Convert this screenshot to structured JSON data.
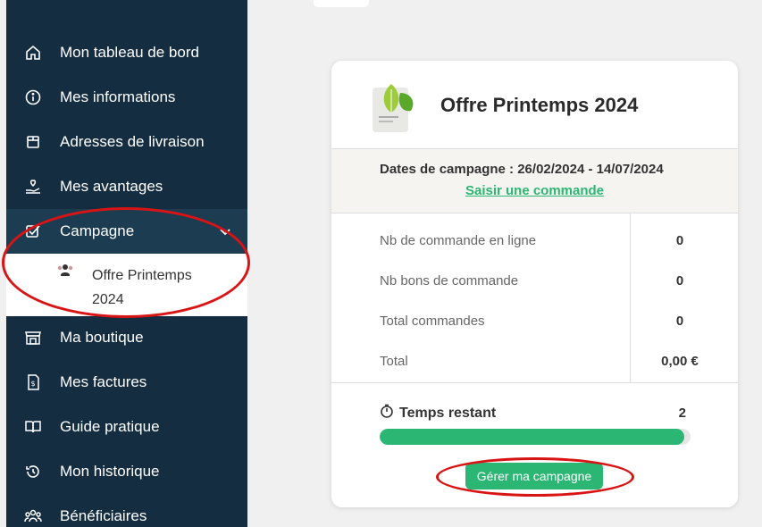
{
  "sidebar": {
    "items": [
      {
        "label": "Mon tableau de bord",
        "icon": "home-icon"
      },
      {
        "label": "Mes informations",
        "icon": "info-icon"
      },
      {
        "label": "Adresses de livraison",
        "icon": "package-icon"
      },
      {
        "label": "Mes avantages",
        "icon": "hand-heart-icon"
      },
      {
        "label": "Campagne",
        "icon": "checkbox-edit-icon"
      },
      {
        "label": "Ma boutique",
        "icon": "store-icon"
      },
      {
        "label": "Mes factures",
        "icon": "invoice-icon"
      },
      {
        "label": "Guide pratique",
        "icon": "book-icon"
      },
      {
        "label": "Mon historique",
        "icon": "history-icon"
      },
      {
        "label": "Bénéficiaires",
        "icon": "users-icon"
      }
    ],
    "sub_item": {
      "label": "Offre Printemps 2024",
      "icon": "group-icon"
    }
  },
  "campaign": {
    "title": "Offre Printemps 2024",
    "dates": "Dates de campagne : 26/02/2024 - 14/07/2024",
    "order_link": "Saisir une commande",
    "stats": [
      {
        "label": "Nb de commande en ligne",
        "value": "0"
      },
      {
        "label": "Nb bons de commande",
        "value": "0"
      },
      {
        "label": "Total commandes",
        "value": "0"
      },
      {
        "label": "Total",
        "value": "0,00 €"
      }
    ],
    "time_label": "Temps restant",
    "time_value": "2",
    "progress": 0.98,
    "manage_button": "Gérer ma campagne"
  },
  "colors": {
    "sidebar": "#142d40",
    "accent": "#2bb673",
    "annotation": "#d81414"
  }
}
